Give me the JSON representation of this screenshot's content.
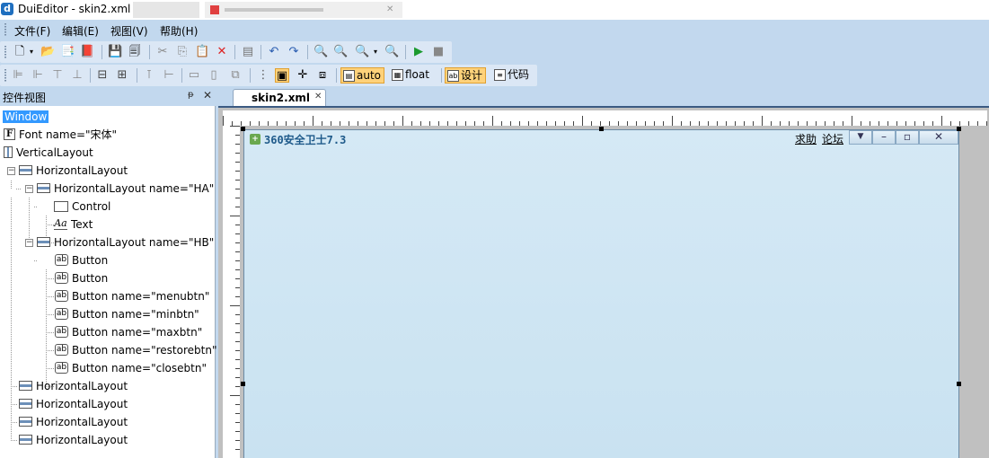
{
  "window": {
    "title": "DuiEditor - skin2.xml",
    "app_icon": "duieditor-app-icon"
  },
  "menu": {
    "items": [
      "文件(F)",
      "编辑(E)",
      "视图(V)",
      "帮助(H)"
    ]
  },
  "toolbar1": {
    "icons": [
      "new-file-icon",
      "dropdown-icon",
      "open-folder-icon",
      "open-recent-icon",
      "import-icon",
      "save-icon",
      "save-all-icon",
      "cut-icon",
      "copy-icon",
      "paste-icon",
      "delete-icon",
      "properties-icon",
      "undo-icon",
      "redo-icon",
      "zoom-in-icon",
      "zoom-out-icon",
      "zoom-fit-icon",
      "zoom-dropdown-icon",
      "zoom-actual-icon",
      "run-icon",
      "stop-icon"
    ]
  },
  "toolbar2": {
    "buttons": {
      "auto_label": "auto",
      "float_label": "float",
      "design_label": "设计",
      "code_label": "代码"
    }
  },
  "panel": {
    "title": "控件视图",
    "pin": "ᵽ",
    "close": "✕"
  },
  "tree": {
    "nodes": [
      {
        "label": "Window"
      },
      {
        "label": "Font name=\"宋体\""
      },
      {
        "label": "VerticalLayout"
      },
      {
        "label": "HorizontalLayout"
      },
      {
        "label": "HorizontalLayout name=\"HA\""
      },
      {
        "label": "Control"
      },
      {
        "label": "Text"
      },
      {
        "label": "HorizontalLayout name=\"HB\""
      },
      {
        "label": "Button"
      },
      {
        "label": "Button"
      },
      {
        "label": "Button name=\"menubtn\""
      },
      {
        "label": "Button name=\"minbtn\""
      },
      {
        "label": "Button name=\"maxbtn\""
      },
      {
        "label": "Button name=\"restorebtn\""
      },
      {
        "label": "Button name=\"closebtn\""
      },
      {
        "label": "HorizontalLayout"
      },
      {
        "label": "HorizontalLayout"
      },
      {
        "label": "HorizontalLayout"
      },
      {
        "label": "HorizontalLayout"
      }
    ]
  },
  "document": {
    "tab_label": "skin2.xml",
    "tab_close": "✕"
  },
  "skin": {
    "title": "360安全卫士7.3",
    "link_help": "求助",
    "link_forum": "论坛",
    "menu_btn": "▼",
    "min_btn": "–",
    "max_btn": "▫",
    "close_btn": "✕"
  }
}
